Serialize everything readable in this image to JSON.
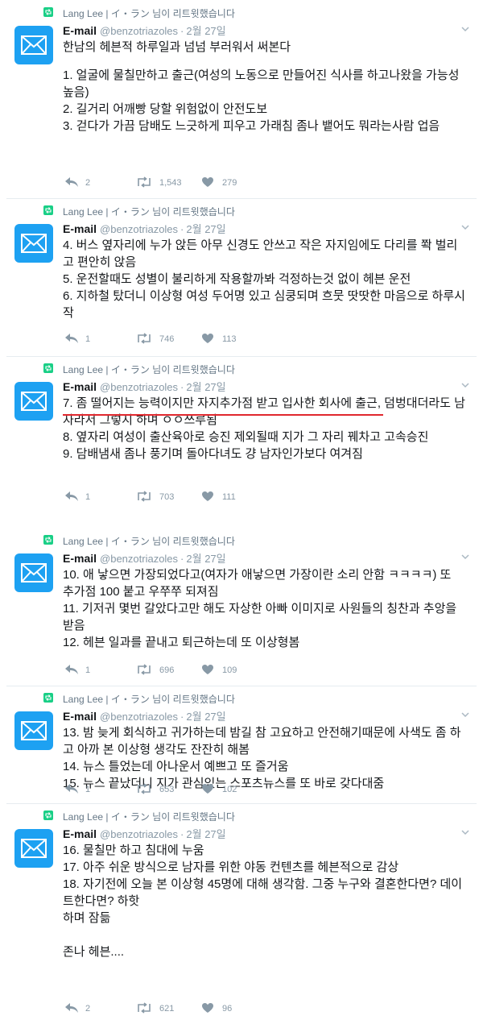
{
  "retweet_label": "Lang Lee | イ・ラン 님이 리트윗했습니다",
  "account": {
    "name": "E-mail",
    "handle": "@benzotriazoles",
    "separator": "·",
    "date": "2월 27일"
  },
  "tweets": [
    {
      "lines": [
        "한남의 헤븐적 하루일과 넘넘 부러워서 써본다",
        "",
        "1. 얼굴에 물칠만하고 출근(여성의 노동으로 만들어진 식사를 하고나왔을 가능성 높음)",
        "2. 길거리 어깨빵 당할 위험없이 안전도보",
        "3. 걷다가 가끔 담배도 느긋하게 피우고 가래침 좀나 뱉어도 뭐라는사람 업음"
      ],
      "replies": "2",
      "retweets": "1,543",
      "likes": "279"
    },
    {
      "lines": [
        "4. 버스 옆자리에 누가 앉든 아무 신경도 안쓰고  작은 자지임에도 다리를 쫙 벌리고 편안히 앉음",
        "5. 운전할때도 성별이 불리하게 작용할까봐 걱정하는것 없이 헤븐 운전",
        "6. 지하철 탔더니 이상형 여성 두어명 있고 심쿵되며 흐뭇 땃땃한 마음으로 하루시작"
      ],
      "replies": "1",
      "retweets": "746",
      "likes": "113"
    },
    {
      "lines": [
        "7. 좀 떨어지는 능력이지만 자지추가점 받고 입사한 회사에 출근, 덤벙대더라도 남자라서 그렇지  하며 ㅇㅇ쓰루됨",
        "8. 옆자리 여성이 출산육아로 승진 제외될때  지가 그 자리 꿰차고 고속승진",
        "9. 담배냄새 좀나 풍기며 돌아다녀도 걍 남자인가보다 여겨짐"
      ],
      "replies": "1",
      "retweets": "703",
      "likes": "111"
    },
    {
      "lines": [
        "10. 애 낳으면  가장되었다고(여자가 애낳으면 가장이란 소리 안함 ㅋㅋㅋㅋ) 또 추가점 100 붙고 우쭈쭈 되져짐",
        "11. 기저귀 몇번 갈았다고만 해도 자상한 아빠 이미지로 사원들의 칭찬과 추앙을 받음",
        "12. 헤븐 일과를 끝내고 퇴근하는데 또 이상형봄"
      ],
      "replies": "1",
      "retweets": "696",
      "likes": "109"
    },
    {
      "lines": [
        "13. 밤 늦게 회식하고 귀가하는데 밤길 참 고요하고 안전해기때문에  사색도 좀 하고  아까 본 이상형 생각도 잔잔히 해봄",
        "14. 뉴스 틀었는데 아나운서 예쁘고 또 즐거움",
        "15. 뉴스 끝났더니 지가 관심있는 스포츠뉴스를 또 바로 갖다대줌"
      ],
      "replies": "1",
      "retweets": "653",
      "likes": "102"
    },
    {
      "lines": [
        "16. 물칠만 하고 침대에 누움",
        "17. 아주 쉬운 방식으로 남자를 위한 야동 컨텐츠를 헤븐적으로 감상",
        "18. 자기전에 오늘 본 이상형 45명에 대해 생각함. 그중 누구와 결혼한다면? 데이트한다면? 하핫",
        "하며 잠듦",
        "",
        "존나 헤븐...."
      ],
      "replies": "2",
      "retweets": "621",
      "likes": "96"
    }
  ],
  "colors": {
    "avatar_bg": "#1da1f2",
    "retweet_green": "#19cf86",
    "meta_gray": "#8899a6",
    "underline_red": "#e0282e"
  },
  "icons": {
    "avatar": "envelope-icon",
    "retweet": "retweet-icon",
    "reply": "reply-icon",
    "like": "heart-icon",
    "menu": "chevron-down-icon"
  }
}
